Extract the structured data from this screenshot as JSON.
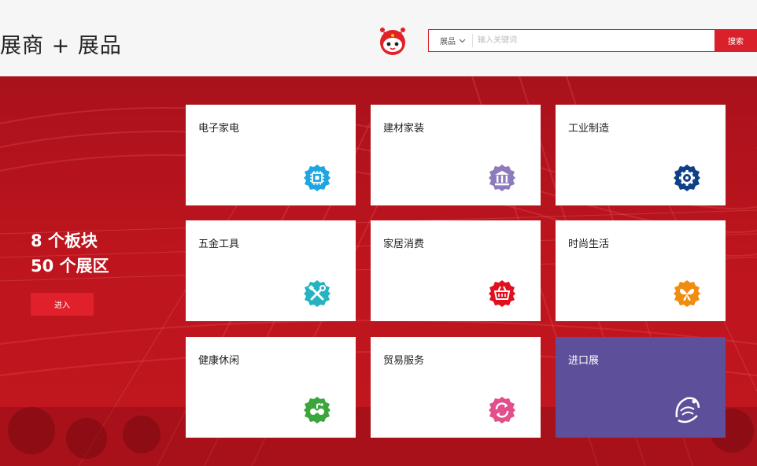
{
  "header": {
    "title": "展商 + 展品",
    "search": {
      "category": "展品",
      "placeholder": "输入关键词",
      "button_label": "搜索"
    }
  },
  "hero": {
    "stats_line1": "8 个板块",
    "stats_line2": "50 个展区",
    "enter_label": "进入"
  },
  "cards": [
    {
      "label": "电子家电",
      "icon": "chip-icon",
      "color": "#1ea6e0"
    },
    {
      "label": "建材家装",
      "icon": "building-icon",
      "color": "#8e7bbd"
    },
    {
      "label": "工业制造",
      "icon": "gear-icon",
      "color": "#0e3f87"
    },
    {
      "label": "五金工具",
      "icon": "tools-icon",
      "color": "#25b3c0"
    },
    {
      "label": "家居消费",
      "icon": "basket-icon",
      "color": "#e0101e"
    },
    {
      "label": "时尚生活",
      "icon": "butterfly-icon",
      "color": "#f08c12"
    },
    {
      "label": "健康休闲",
      "icon": "leisure-icon",
      "color": "#3ca53c"
    },
    {
      "label": "贸易服务",
      "icon": "exchange-icon",
      "color": "#e2508c"
    },
    {
      "label": "进口展",
      "icon": "international-pavilion-logo",
      "color": "#5d4f9a"
    }
  ]
}
